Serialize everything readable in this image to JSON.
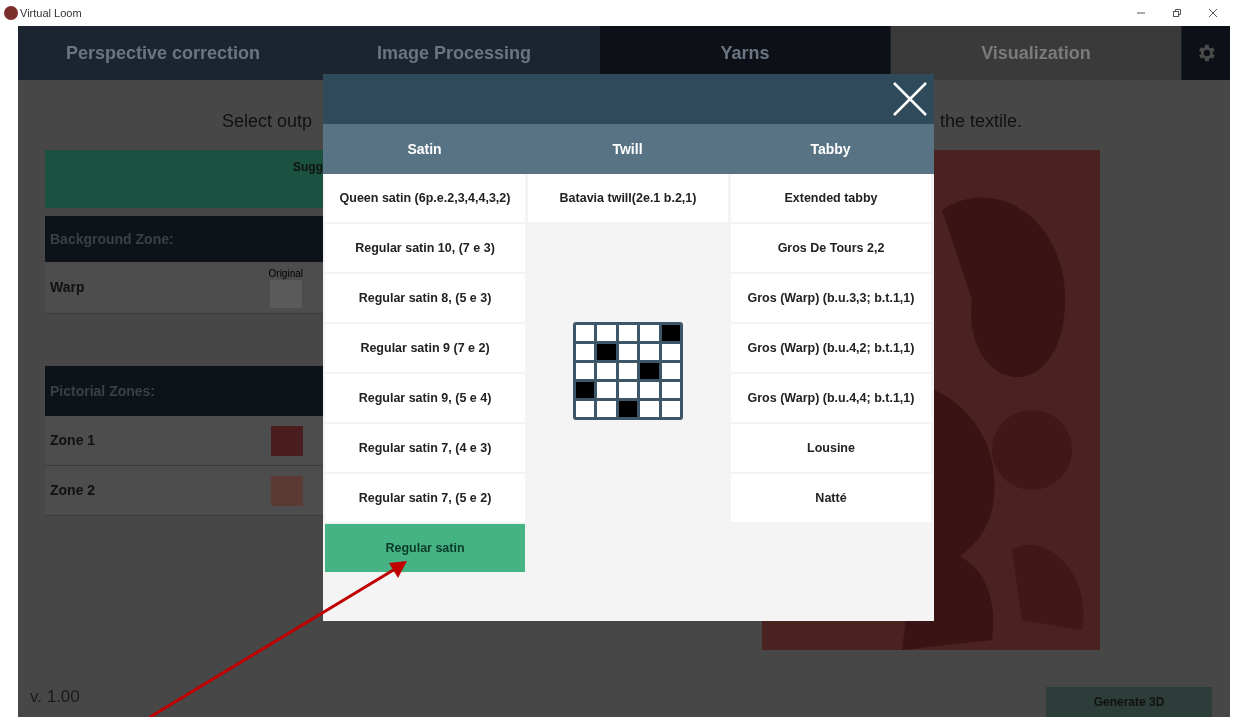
{
  "window": {
    "title": "Virtual Loom"
  },
  "tabs": [
    {
      "label": "Perspective correction",
      "selected": false,
      "disabled": false
    },
    {
      "label": "Image Processing",
      "selected": false,
      "disabled": false
    },
    {
      "label": "Yarns",
      "selected": true,
      "disabled": false
    },
    {
      "label": "Visualization",
      "selected": false,
      "disabled": true
    }
  ],
  "instruction": {
    "left_part": "Select outp",
    "right_part": "the textile."
  },
  "suggestion_bar": {
    "text": "Sugg"
  },
  "background_zone": {
    "title": "Background Zone:",
    "rows": [
      {
        "label": "Warp",
        "swatch_caption": "Original",
        "color": "#5a5a5a"
      }
    ]
  },
  "pictorial_zones": {
    "title": "Pictorial Zones:",
    "rows": [
      {
        "label": "Zone 1",
        "color": "#4a1e1e"
      },
      {
        "label": "Zone 2",
        "color": "#5a3a33"
      }
    ]
  },
  "version": "v. 1.00",
  "generate_button": "Generate 3D",
  "dialog": {
    "columns": [
      {
        "header": "Satin",
        "items": [
          {
            "label": "Queen satin (6p.e.2,3,4,4,3,2)",
            "selected": false
          },
          {
            "label": "Regular satin 10, (7 e 3)",
            "selected": false
          },
          {
            "label": "Regular satin 8, (5 e 3)",
            "selected": false
          },
          {
            "label": "Regular satin 9 (7 e 2)",
            "selected": false
          },
          {
            "label": "Regular satin 9, (5 e 4)",
            "selected": false
          },
          {
            "label": "Regular satin 7, (4 e 3)",
            "selected": false
          },
          {
            "label": "Regular satin 7, (5 e 2)",
            "selected": false
          },
          {
            "label": "Regular satin",
            "selected": true
          }
        ]
      },
      {
        "header": "Twill",
        "items": [
          {
            "label": "Batavia twill(2e.1 b.2,1)",
            "selected": false
          }
        ]
      },
      {
        "header": "Tabby",
        "items": [
          {
            "label": "Extended tabby",
            "selected": false
          },
          {
            "label": "Gros De Tours 2,2",
            "selected": false
          },
          {
            "label": "Gros (Warp) (b.u.3,3; b.t.1,1)",
            "selected": false
          },
          {
            "label": "Gros (Warp)  (b.u.4,2; b.t.1,1)",
            "selected": false
          },
          {
            "label": "Gros (Warp) (b.u.4,4; b.t.1,1)",
            "selected": false
          },
          {
            "label": "Lousine",
            "selected": false
          },
          {
            "label": "Natté",
            "selected": false
          }
        ]
      }
    ],
    "weave_preview": [
      [
        false,
        false,
        false,
        false,
        true
      ],
      [
        false,
        true,
        false,
        false,
        false
      ],
      [
        false,
        false,
        false,
        true,
        false
      ],
      [
        true,
        false,
        false,
        false,
        false
      ],
      [
        false,
        false,
        true,
        false,
        false
      ]
    ]
  }
}
